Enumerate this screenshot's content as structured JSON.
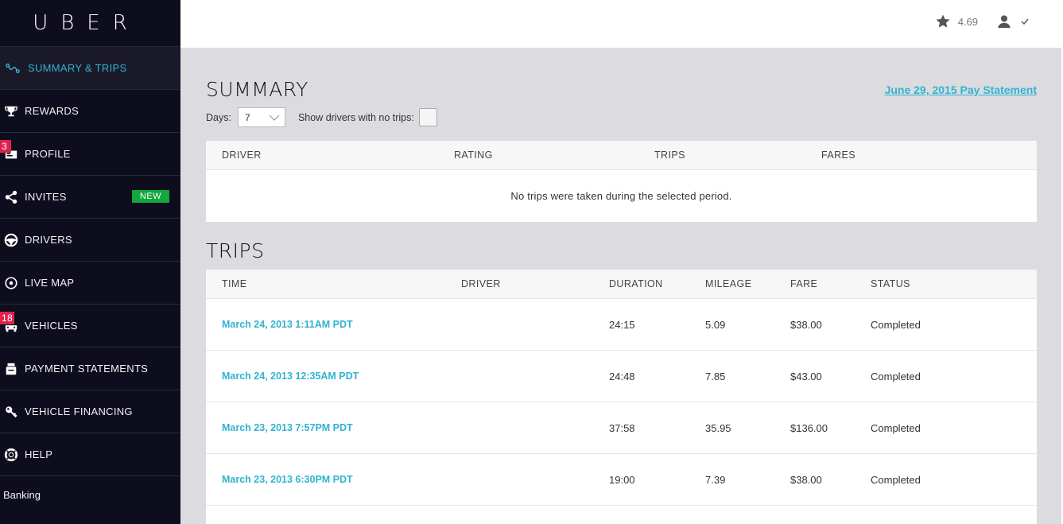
{
  "brand": {
    "logo": "UBER"
  },
  "sidebar": {
    "items": [
      {
        "label": "SUMMARY & TRIPS",
        "icon": "trips-icon",
        "active": true
      },
      {
        "label": "REWARDS",
        "icon": "trophy-icon"
      },
      {
        "label": "PROFILE",
        "icon": "profile-card-icon",
        "badge": "3"
      },
      {
        "label": "INVITES",
        "icon": "share-icon",
        "tag": "NEW"
      },
      {
        "label": "DRIVERS",
        "icon": "steering-wheel-icon"
      },
      {
        "label": "LIVE MAP",
        "icon": "target-icon"
      },
      {
        "label": "VEHICLES",
        "icon": "car-icon",
        "badge": "18"
      },
      {
        "label": "PAYMENT STATEMENTS",
        "icon": "statement-icon"
      },
      {
        "label": "VEHICLE FINANCING",
        "icon": "key-icon"
      },
      {
        "label": "HELP",
        "icon": "lifebuoy-icon"
      }
    ],
    "extra": "Banking"
  },
  "topbar": {
    "rating": "4.69",
    "icons": [
      "star-icon",
      "user-icon",
      "check-icon"
    ]
  },
  "summary": {
    "title": "SUMMARY",
    "pay_link": "June 29, 2015 Pay Statement",
    "days_label": "Days:",
    "days_value": "7",
    "show_label": "Show drivers with no trips:",
    "columns": [
      "DRIVER",
      "RATING",
      "TRIPS",
      "FARES"
    ],
    "empty_message": "No trips were taken during the selected period."
  },
  "trips": {
    "title": "TRIPS",
    "columns": [
      "TIME",
      "DRIVER",
      "DURATION",
      "MILEAGE",
      "FARE",
      "STATUS"
    ],
    "rows": [
      {
        "time": "March 24, 2013 1:11AM PDT",
        "driver": "",
        "duration": "24:15",
        "mileage": "5.09",
        "fare": "$38.00",
        "status": "Completed"
      },
      {
        "time": "March 24, 2013 12:35AM PDT",
        "driver": "",
        "duration": "24:48",
        "mileage": "7.85",
        "fare": "$43.00",
        "status": "Completed"
      },
      {
        "time": "March 23, 2013 7:57PM PDT",
        "driver": "",
        "duration": "37:58",
        "mileage": "35.95",
        "fare": "$136.00",
        "status": "Completed"
      },
      {
        "time": "March 23, 2013 6:30PM PDT",
        "driver": "",
        "duration": "19:00",
        "mileage": "7.39",
        "fare": "$38.00",
        "status": "Completed"
      }
    ]
  },
  "colors": {
    "accent": "#30b3d0",
    "sidebar_bg": "#0e0d1e",
    "badge_red": "#e0234e",
    "new_green": "#11a83c"
  }
}
